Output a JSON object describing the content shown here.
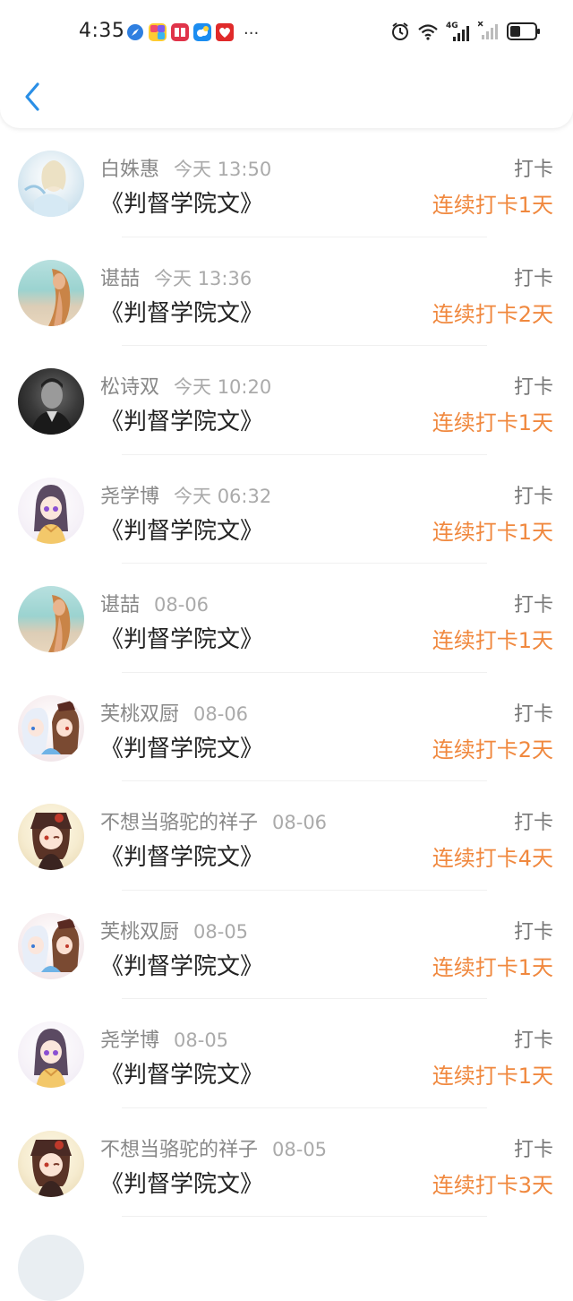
{
  "status_bar": {
    "time": "4:35",
    "app_icons": [
      {
        "name": "compass-app-icon",
        "color": "#2f7fe0"
      },
      {
        "name": "colorful-app-icon",
        "color": "#f24b6a"
      },
      {
        "name": "book-app-icon",
        "color": "#e0344a"
      },
      {
        "name": "cloud-app-icon",
        "color": "#1c8df0"
      },
      {
        "name": "heart-app-icon",
        "color": "#e02a2a"
      }
    ],
    "more": "···",
    "network_label": "4G"
  },
  "colors": {
    "accent_blue": "#2a8fe6",
    "streak_orange": "#f0883e",
    "name_gray": "#888888",
    "time_gray": "#aaaaaa",
    "title_black": "#222222"
  },
  "list": {
    "items": [
      {
        "avatar": "fantasy-illustration-avatar",
        "name": "白姝惠",
        "time": "今天 13:50",
        "title": "《判督学院文》",
        "tag": "打卡",
        "streak": "连续打卡1天"
      },
      {
        "avatar": "beach-woman-avatar",
        "name": "谌喆",
        "time": "今天 13:36",
        "title": "《判督学院文》",
        "tag": "打卡",
        "streak": "连续打卡2天"
      },
      {
        "avatar": "bw-man-avatar",
        "name": "松诗双",
        "time": "今天 10:20",
        "title": "《判督学院文》",
        "tag": "打卡",
        "streak": "连续打卡1天"
      },
      {
        "avatar": "anime-purple-hair-avatar",
        "name": "尧学博",
        "time": "今天 06:32",
        "title": "《判督学院文》",
        "tag": "打卡",
        "streak": "连续打卡1天"
      },
      {
        "avatar": "beach-woman-avatar",
        "name": "谌喆",
        "time": "08-06",
        "title": "《判督学院文》",
        "tag": "打卡",
        "streak": "连续打卡1天"
      },
      {
        "avatar": "anime-duo-avatar",
        "name": "芙桃双厨",
        "time": "08-06",
        "title": "《判督学院文》",
        "tag": "打卡",
        "streak": "连续打卡2天"
      },
      {
        "avatar": "hutao-avatar",
        "name": "不想当骆驼的祥子",
        "time": "08-06",
        "title": "《判督学院文》",
        "tag": "打卡",
        "streak": "连续打卡4天"
      },
      {
        "avatar": "anime-duo-avatar",
        "name": "芙桃双厨",
        "time": "08-05",
        "title": "《判督学院文》",
        "tag": "打卡",
        "streak": "连续打卡1天"
      },
      {
        "avatar": "anime-purple-hair-avatar",
        "name": "尧学博",
        "time": "08-05",
        "title": "《判督学院文》",
        "tag": "打卡",
        "streak": "连续打卡1天"
      },
      {
        "avatar": "hutao-avatar",
        "name": "不想当骆驼的祥子",
        "time": "08-05",
        "title": "《判督学院文》",
        "tag": "打卡",
        "streak": "连续打卡3天"
      }
    ]
  }
}
